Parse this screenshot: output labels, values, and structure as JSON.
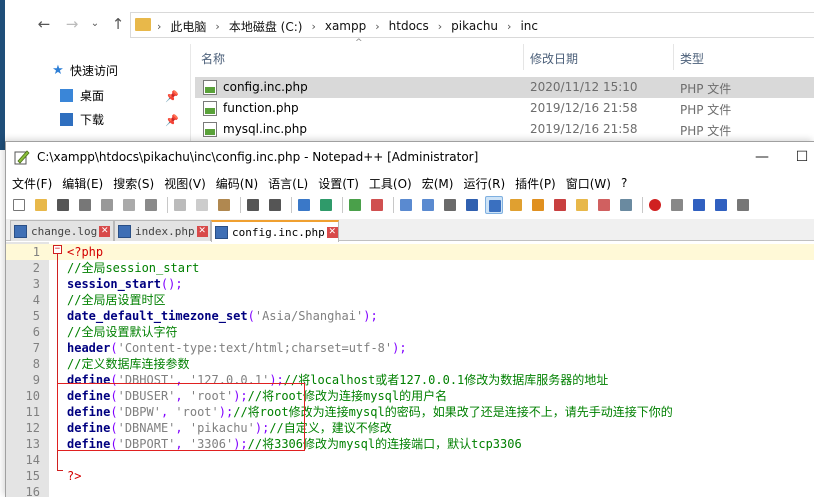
{
  "explorer": {
    "breadcrumb": [
      "此电脑",
      "本地磁盘 (C:)",
      "xampp",
      "htdocs",
      "pikachu",
      "inc"
    ],
    "sidebar": [
      {
        "label": "快速访问",
        "icon": "star-icon"
      },
      {
        "label": "桌面",
        "icon": "desktop-folder-icon"
      },
      {
        "label": "下载",
        "icon": "download-folder-icon"
      }
    ],
    "columns": {
      "name": "名称",
      "date": "修改日期",
      "type": "类型"
    },
    "files": [
      {
        "name": "config.inc.php",
        "date": "2020/11/12 15:10",
        "type": "PHP 文件",
        "selected": true
      },
      {
        "name": "function.php",
        "date": "2019/12/16 21:58",
        "type": "PHP 文件",
        "selected": false
      },
      {
        "name": "mysql.inc.php",
        "date": "2019/12/16 21:58",
        "type": "PHP 文件",
        "selected": false
      }
    ]
  },
  "npp": {
    "title": "C:\\xampp\\htdocs\\pikachu\\inc\\config.inc.php - Notepad++ [Administrator]",
    "menu": [
      "文件(F)",
      "编辑(E)",
      "搜索(S)",
      "视图(V)",
      "编码(N)",
      "语言(L)",
      "设置(T)",
      "工具(O)",
      "宏(M)",
      "运行(R)",
      "插件(P)",
      "窗口(W)",
      "?"
    ],
    "tabs": [
      {
        "label": "change.log",
        "active": false
      },
      {
        "label": "index.php",
        "active": false
      },
      {
        "label": "config.inc.php",
        "active": true
      }
    ],
    "lines": [
      {
        "n": "1",
        "tokens": [
          [
            "tag",
            "<?php"
          ]
        ]
      },
      {
        "n": "2",
        "tokens": [
          [
            "com",
            "//全局session_start"
          ]
        ]
      },
      {
        "n": "3",
        "tokens": [
          [
            "fn",
            "session_start"
          ],
          [
            "op",
            "();"
          ]
        ]
      },
      {
        "n": "4",
        "tokens": [
          [
            "com",
            "//全局居设置时区"
          ]
        ]
      },
      {
        "n": "5",
        "tokens": [
          [
            "fn",
            "date_default_timezone_set"
          ],
          [
            "op",
            "("
          ],
          [
            "str",
            "'Asia/Shanghai'"
          ],
          [
            "op",
            ");"
          ]
        ]
      },
      {
        "n": "6",
        "tokens": [
          [
            "com",
            "//全局设置默认字符"
          ]
        ]
      },
      {
        "n": "7",
        "tokens": [
          [
            "fn",
            "header"
          ],
          [
            "op",
            "("
          ],
          [
            "str",
            "'Content-type:text/html;charset=utf-8'"
          ],
          [
            "op",
            ");"
          ]
        ]
      },
      {
        "n": "8",
        "tokens": [
          [
            "com",
            "//定义数据库连接参数"
          ]
        ]
      },
      {
        "n": "9",
        "tokens": [
          [
            "fn",
            "define"
          ],
          [
            "op",
            "("
          ],
          [
            "str",
            "'DBHOST'"
          ],
          [
            "op",
            ", "
          ],
          [
            "str",
            "'127.0.0.1'"
          ],
          [
            "op",
            ");"
          ],
          [
            "com",
            "//将localhost或者127.0.0.1修改为数据库服务器的地址"
          ]
        ]
      },
      {
        "n": "10",
        "tokens": [
          [
            "fn",
            "define"
          ],
          [
            "op",
            "("
          ],
          [
            "str",
            "'DBUSER'"
          ],
          [
            "op",
            ", "
          ],
          [
            "str",
            "'root'"
          ],
          [
            "op",
            ");"
          ],
          [
            "com",
            "//将root修改为连接mysql的用户名"
          ]
        ]
      },
      {
        "n": "11",
        "tokens": [
          [
            "fn",
            "define"
          ],
          [
            "op",
            "("
          ],
          [
            "str",
            "'DBPW'"
          ],
          [
            "op",
            ", "
          ],
          [
            "str",
            "'root'"
          ],
          [
            "op",
            ");"
          ],
          [
            "com",
            "//将root修改为连接mysql的密码，如果改了还是连接不上，请先手动连接下你的"
          ]
        ]
      },
      {
        "n": "12",
        "tokens": [
          [
            "fn",
            "define"
          ],
          [
            "op",
            "("
          ],
          [
            "str",
            "'DBNAME'"
          ],
          [
            "op",
            ", "
          ],
          [
            "str",
            "'pikachu'"
          ],
          [
            "op",
            ");"
          ],
          [
            "com",
            "//自定义，建议不修改"
          ]
        ]
      },
      {
        "n": "13",
        "tokens": [
          [
            "fn",
            "define"
          ],
          [
            "op",
            "("
          ],
          [
            "str",
            "'DBPORT'"
          ],
          [
            "op",
            ", "
          ],
          [
            "str",
            "'3306'"
          ],
          [
            "op",
            ");"
          ],
          [
            "com",
            "//将3306修改为mysql的连接端口，默认tcp3306"
          ]
        ]
      },
      {
        "n": "14",
        "tokens": []
      },
      {
        "n": "15",
        "tokens": [
          [
            "tag",
            "?>"
          ]
        ]
      },
      {
        "n": "16",
        "tokens": []
      }
    ],
    "current_line": "1"
  }
}
